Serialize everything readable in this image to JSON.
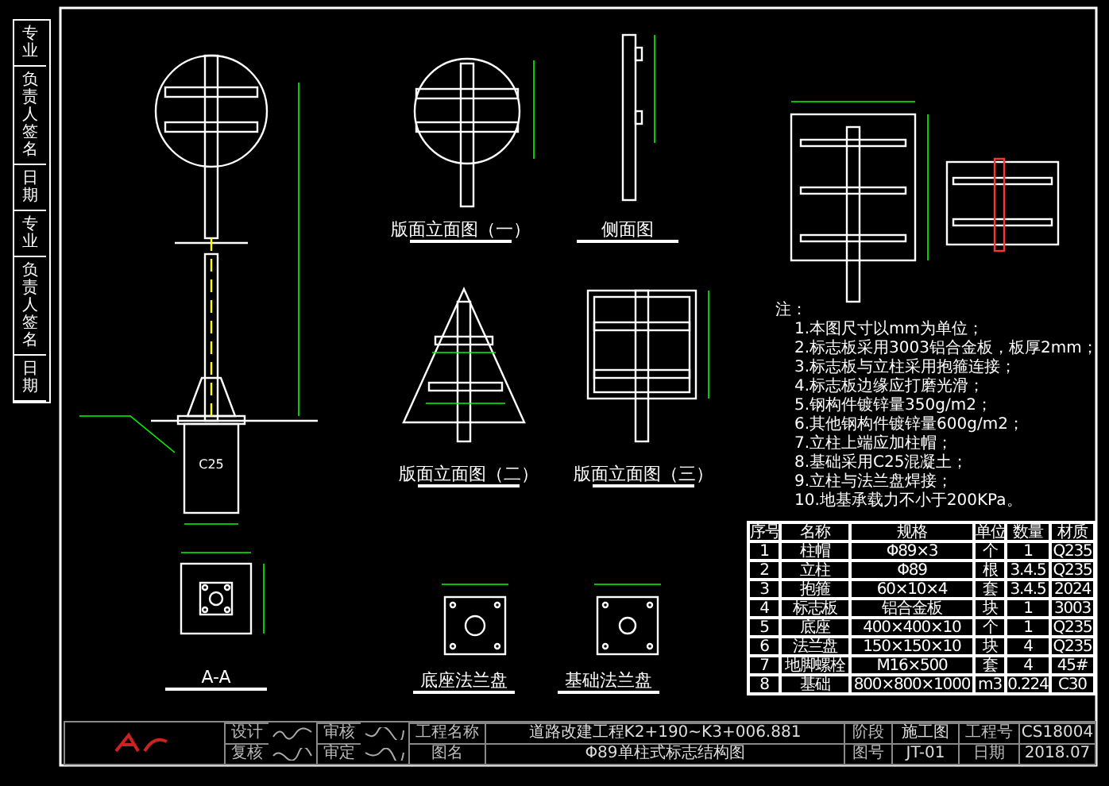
{
  "margin_labels": [
    "专业",
    "负责人签名",
    "日期",
    "专业",
    "负责人签名",
    "日期"
  ],
  "views": [
    {
      "kind": "elevation_round",
      "title": "版面立面图（一）"
    },
    {
      "kind": "side",
      "title": "侧面图"
    },
    {
      "kind": "elevation_triangle",
      "title": "版面立面图（二）"
    },
    {
      "kind": "elevation_square",
      "title": "版面立面图（三）"
    },
    {
      "kind": "section",
      "title": "A-A"
    },
    {
      "kind": "base_flange",
      "title": "底座法兰盘"
    },
    {
      "kind": "foundation_flange",
      "title": "基础法兰盘"
    }
  ],
  "concrete_label": "C25",
  "notes": {
    "heading": "注：",
    "lines": [
      "1.本图尺寸以mm为单位；",
      "2.标志板采用3003铝合金板，板厚2mm；",
      "3.标志板与立柱采用抱箍连接；",
      "4.标志板边缘应打磨光滑；",
      "5.钢构件镀锌量350g/m2；",
      "6.其他钢构件镀锌量600g/m2；",
      "7.立柱上端应加柱帽；",
      "8.基础采用C25混凝土；",
      "9.立柱与法兰盘焊接；",
      "10.地基承载力不小于200KPa。"
    ]
  },
  "table": {
    "columns": [
      "序号",
      "名称",
      "规格",
      "单位",
      "数量",
      "材质"
    ],
    "rows": [
      [
        "1",
        "柱帽",
        "Φ89×3",
        "个",
        "1",
        "Q235"
      ],
      [
        "2",
        "立柱",
        "Φ89",
        "根",
        "3.4.5",
        "Q235"
      ],
      [
        "3",
        "抱箍",
        "60×10×4",
        "套",
        "3.4.5",
        "2024"
      ],
      [
        "4",
        "标志板",
        "铝合金板",
        "块",
        "1",
        "3003"
      ],
      [
        "5",
        "底座",
        "400×400×10",
        "个",
        "1",
        "Q235"
      ],
      [
        "6",
        "法兰盘",
        "150×150×10",
        "块",
        "4",
        "Q235"
      ],
      [
        "7",
        "地脚螺栓",
        "M16×500",
        "套",
        "4",
        "45#"
      ],
      [
        "8",
        "基础",
        "800×800×1000",
        "m3",
        "0.224",
        "C30"
      ]
    ]
  },
  "title_block": {
    "roles": [
      "设计",
      "审核",
      "复核",
      "审定"
    ],
    "project_label": "工程名称",
    "project": "道路改建工程K2+190~K3+006.881",
    "drawing_label": "图名",
    "drawing": "Φ89单柱式标志结构图",
    "stage_label": "阶段",
    "stage": "施工图",
    "number_label": "图号",
    "number": "JT-01",
    "job_label": "工程号",
    "job": "CS18004",
    "date_label": "日期",
    "date": "2018.07"
  }
}
